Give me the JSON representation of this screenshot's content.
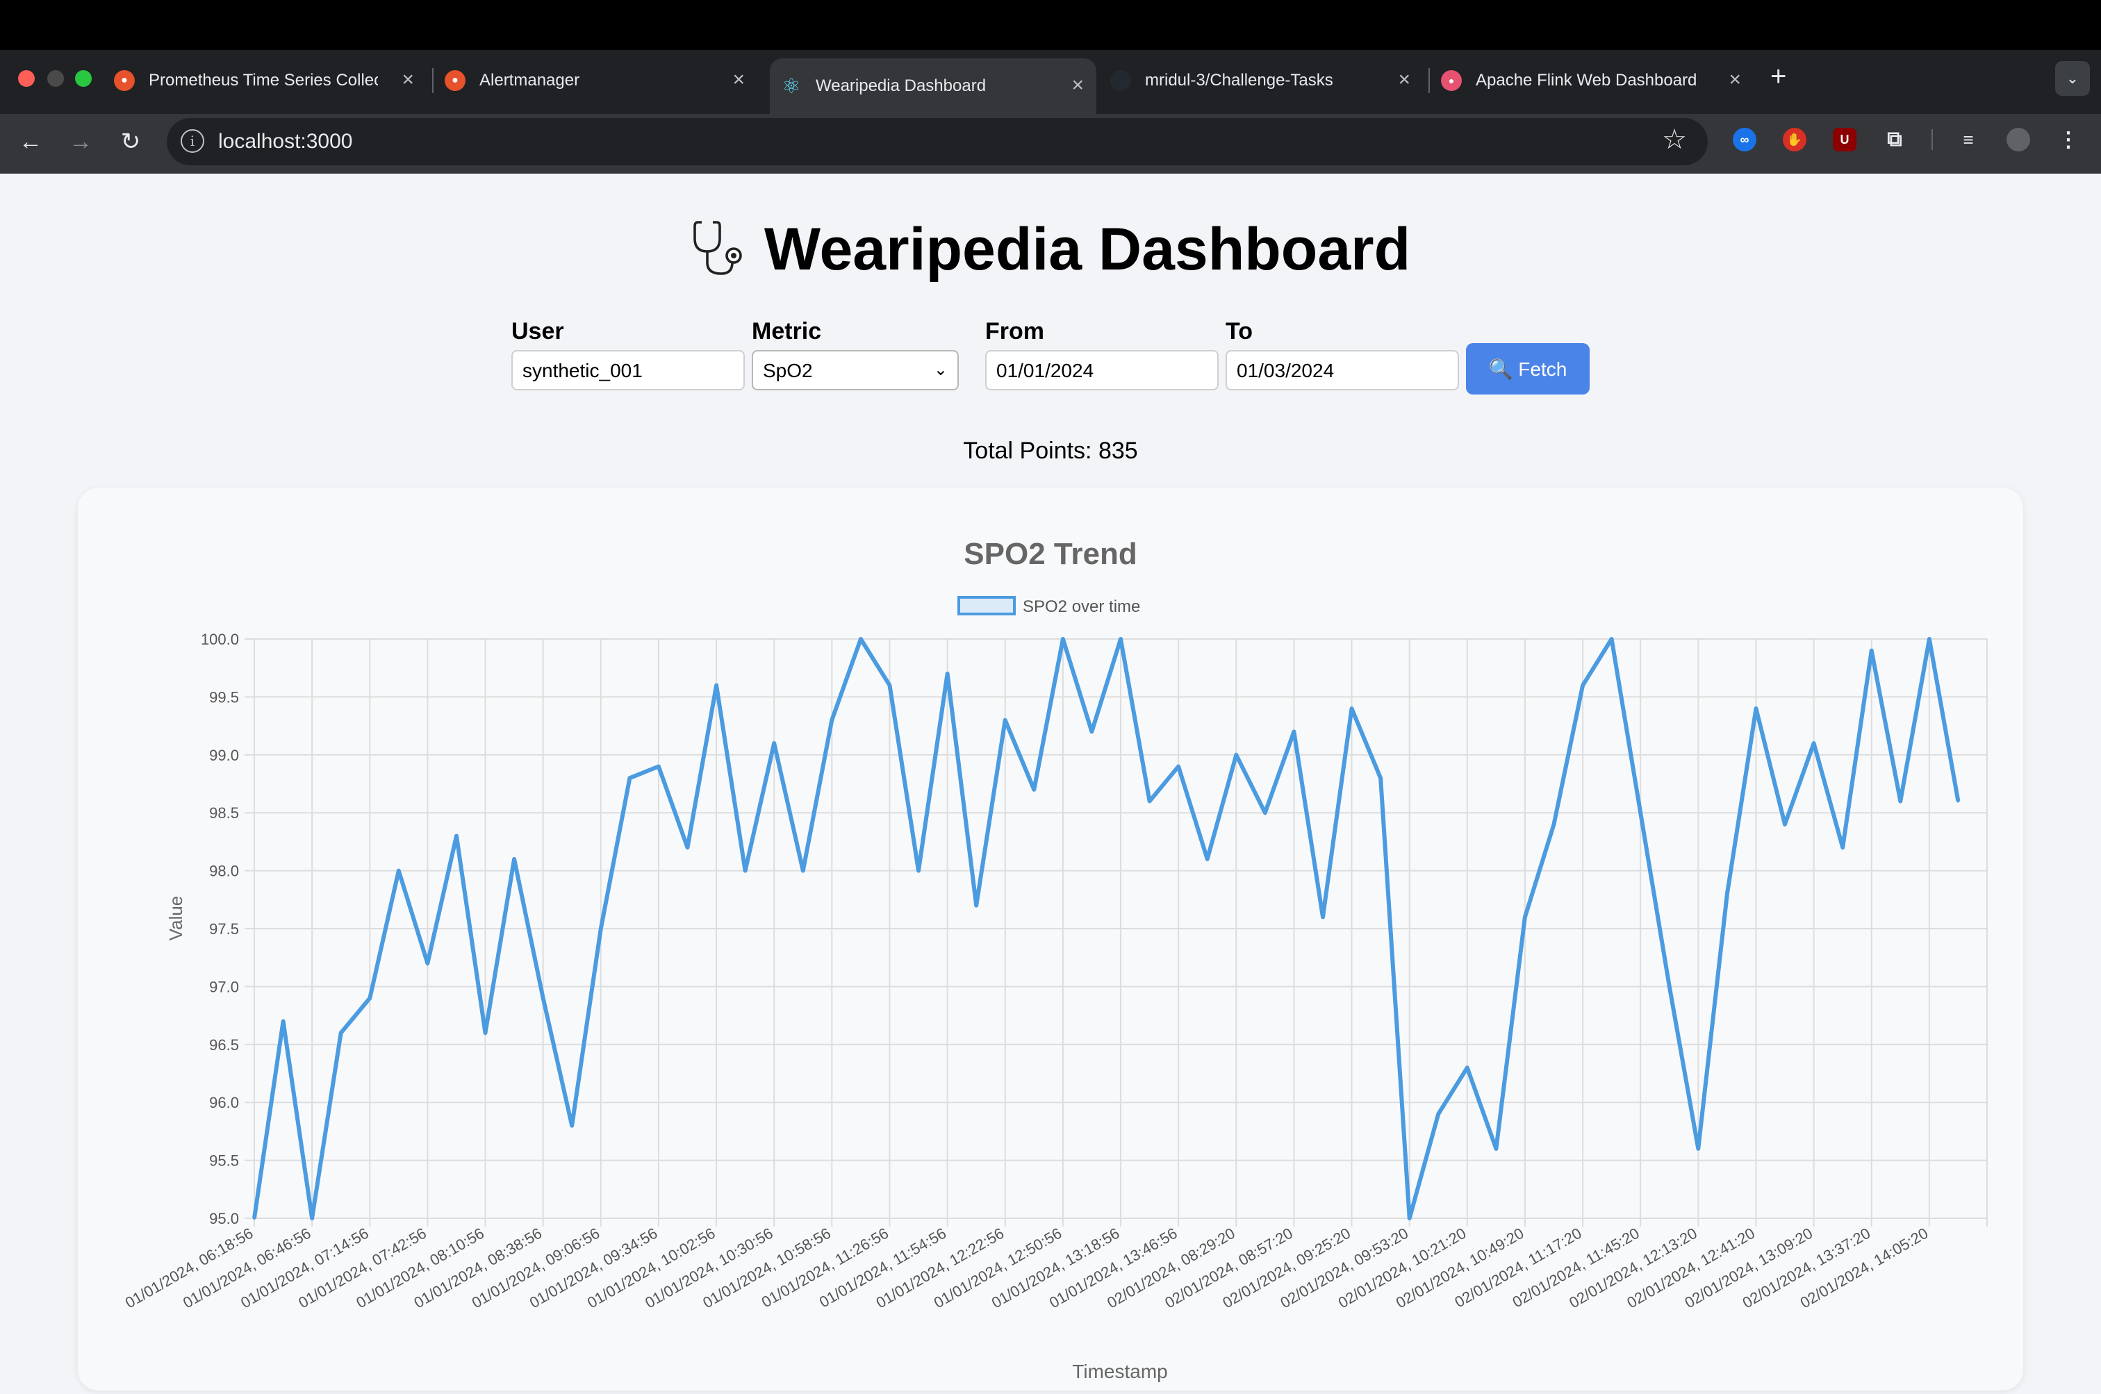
{
  "browser": {
    "tabs": [
      {
        "title": "Prometheus Time Series Collection",
        "icon": "prometheus-icon",
        "icon_color": "#e6522c"
      },
      {
        "title": "Alertmanager",
        "icon": "prometheus-icon",
        "icon_color": "#e6522c"
      },
      {
        "title": "Wearipedia Dashboard",
        "icon": "react-icon",
        "icon_color": "#61dafb"
      },
      {
        "title": "mridul-3/Challenge-Tasks",
        "icon": "github-icon",
        "icon_color": "#24292f"
      },
      {
        "title": "Apache Flink Web Dashboard",
        "icon": "flink-icon",
        "icon_color": "#e6526f"
      }
    ],
    "active_tab_index": 2,
    "url": "localhost:3000"
  },
  "dashboard": {
    "title": "Wearipedia Dashboard",
    "title_icon": "stethoscope-icon",
    "user_label": "User",
    "user_value": "synthetic_001",
    "metric_label": "Metric",
    "metric_value": "SpO2",
    "from_label": "From",
    "from_value": "01/01/2024",
    "to_label": "To",
    "to_value": "01/03/2024",
    "fetch_label": "🔍 Fetch",
    "total_points": "Total Points: 835"
  },
  "chart_data": {
    "type": "line",
    "title": "SPO2 Trend",
    "xlabel": "Timestamp",
    "ylabel": "Value",
    "ylim": [
      95.0,
      100.0
    ],
    "y_ticks": [
      "95.0",
      "95.5",
      "96.0",
      "96.5",
      "97.0",
      "97.5",
      "98.0",
      "98.5",
      "99.0",
      "99.5",
      "100.0"
    ],
    "legend_position": "top-center",
    "grid": true,
    "line_color": "#4b9be0",
    "x_tick_labels": [
      "01/01/2024, 06:18:56",
      "01/01/2024, 06:46:56",
      "01/01/2024, 07:14:56",
      "01/01/2024, 07:42:56",
      "01/01/2024, 08:10:56",
      "01/01/2024, 08:38:56",
      "01/01/2024, 09:06:56",
      "01/01/2024, 09:34:56",
      "01/01/2024, 10:02:56",
      "01/01/2024, 10:30:56",
      "01/01/2024, 10:58:56",
      "01/01/2024, 11:26:56",
      "01/01/2024, 11:54:56",
      "01/01/2024, 12:22:56",
      "01/01/2024, 12:50:56",
      "01/01/2024, 13:18:56",
      "01/01/2024, 13:46:56",
      "02/01/2024, 08:29:20",
      "02/01/2024, 08:57:20",
      "02/01/2024, 09:25:20",
      "02/01/2024, 09:53:20",
      "02/01/2024, 10:21:20",
      "02/01/2024, 10:49:20",
      "02/01/2024, 11:17:20",
      "02/01/2024, 11:45:20",
      "02/01/2024, 12:13:20",
      "02/01/2024, 12:41:20",
      "02/01/2024, 13:09:20",
      "02/01/2024, 13:37:20",
      "02/01/2024, 14:05:20"
    ],
    "series": [
      {
        "name": "SPO2 over time",
        "x": [
          0,
          0.5,
          1,
          1.5,
          2,
          2.5,
          3,
          3.5,
          4,
          4.5,
          5,
          5.5,
          6,
          6.5,
          7,
          7.5,
          8,
          8.5,
          9,
          9.5,
          10,
          10.5,
          11,
          11.5,
          12,
          12.5,
          13,
          13.5,
          14,
          14.5,
          15,
          15.5,
          16,
          16.5,
          17,
          17.5,
          18,
          18.5,
          19,
          19.5,
          20,
          20.5,
          21,
          21.5,
          22,
          22.5,
          23,
          23.5,
          24,
          24.5,
          25,
          25.5,
          26,
          26.5,
          27,
          27.5,
          28,
          28.5,
          29,
          29.5
        ],
        "values": [
          95.0,
          96.7,
          95.0,
          96.6,
          96.9,
          98.0,
          97.2,
          98.3,
          96.6,
          98.1,
          96.9,
          95.8,
          97.5,
          98.8,
          98.9,
          98.2,
          99.6,
          98.0,
          99.1,
          98.0,
          99.3,
          100.0,
          99.6,
          98.0,
          99.7,
          97.7,
          99.3,
          98.7,
          100.0,
          99.2,
          100.0,
          98.6,
          98.9,
          98.1,
          99.0,
          98.5,
          99.2,
          97.6,
          99.4,
          98.8,
          95.0,
          95.9,
          96.3,
          95.6,
          97.6,
          98.4,
          99.6,
          100.0,
          98.5,
          97.0,
          95.6,
          97.8,
          99.4,
          98.4,
          99.1,
          98.2,
          99.9,
          98.6,
          100.0,
          98.6
        ]
      }
    ]
  }
}
